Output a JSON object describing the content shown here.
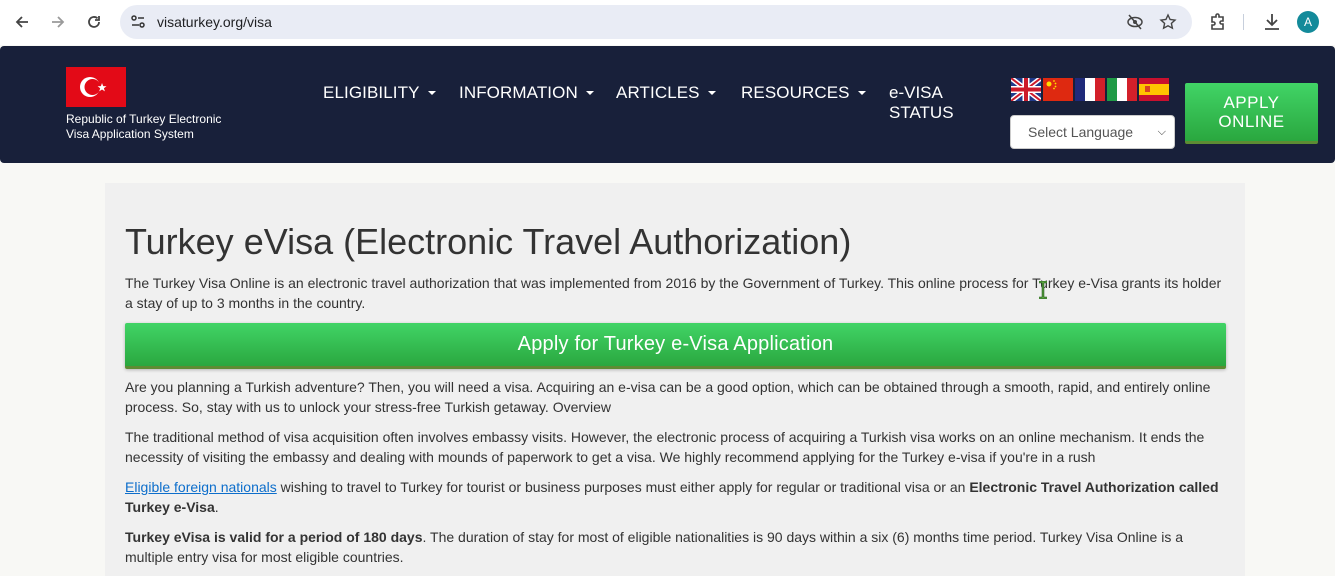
{
  "browser": {
    "url": "visaturkey.org/visa",
    "profile_initial": "A",
    "icons": [
      "back-arrow",
      "forward-arrow",
      "reload",
      "site-settings",
      "eye-slash",
      "star",
      "extensions-puzzle",
      "download",
      "avatar"
    ]
  },
  "header": {
    "logo_text_line1": "Republic of Turkey Electronic",
    "logo_text_line2": "Visa Application System",
    "menu": [
      {
        "label": "ELIGIBILITY",
        "dropdown": true
      },
      {
        "label": "INFORMATION",
        "dropdown": true
      },
      {
        "label": "ARTICLES",
        "dropdown": true
      },
      {
        "label": "RESOURCES",
        "dropdown": true
      }
    ],
    "status_line1": "e-VISA",
    "status_line2": "STATUS",
    "flags": [
      "uk",
      "china",
      "france",
      "italy",
      "spain"
    ],
    "language_select": "Select Language",
    "apply_line1": "APPLY",
    "apply_line2": "ONLINE",
    "colors": {
      "navy": "#18203a",
      "green": "#34c452",
      "flag_red": "#e30a17"
    }
  },
  "main": {
    "title": "Turkey eVisa (Electronic Travel Authorization)",
    "intro": "The Turkey Visa Online is an electronic travel authorization that was implemented from 2016 by the Government of Turkey. This online process for Turkey e-Visa grants its holder a stay of up to 3 months in the country.",
    "apply_button": "Apply for Turkey e-Visa Application",
    "para1": "Are you planning a Turkish adventure? Then, you will need a visa. Acquiring an e-visa can be a good option, which can be obtained through a smooth, rapid, and entirely online process. So, stay with us to unlock your stress-free Turkish getaway. Overview",
    "para2": "The traditional method of visa acquisition often involves embassy visits. However, the electronic process of acquiring a Turkish visa works on an online mechanism. It ends the necessity of visiting the embassy and dealing with mounds of paperwork to get a visa. We highly recommend applying for the Turkey e-visa if you're in a rush",
    "para3_link": "Eligible foreign nationals",
    "para3_text": " wishing to travel to Turkey for tourist or business purposes must either apply for regular or traditional visa or an ",
    "para3_bold": "Electronic Travel Authorization called Turkey e-Visa",
    "para3_end": ".",
    "para4_bold": "Turkey eVisa is valid for a period of 180 days",
    "para4_text": ". The duration of stay for most of eligible nationalities is 90 days within a six (6) months time period. Turkey Visa Online is a multiple entry visa for most eligible countries."
  }
}
